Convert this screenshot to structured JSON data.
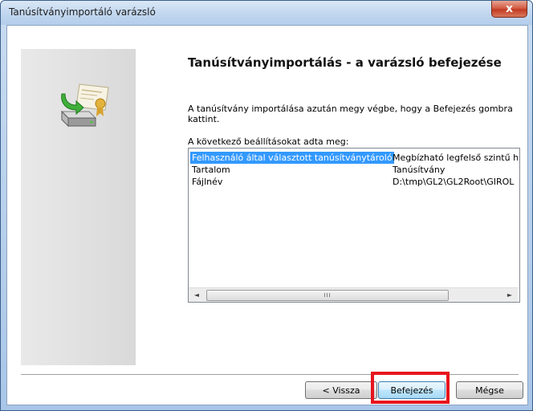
{
  "window": {
    "title": "Tanúsítványimportáló varázsló",
    "close_glyph": "x"
  },
  "icons": {
    "wizard": "certificate-import-icon",
    "close": "close-icon"
  },
  "heading": "Tanúsítványimportálás - a varázsló befejezése",
  "description": "A tanúsítvány importálása azután megy végbe, hogy a Befejezés gombra kattint.",
  "settings_label": "A következő beállításokat adta meg:",
  "settings": [
    {
      "name": "Felhasználó által választott tanúsítványtároló",
      "value": "Megbízható legfelső szintű hi",
      "selected": true
    },
    {
      "name": "Tartalom",
      "value": "Tanúsítvány",
      "selected": false
    },
    {
      "name": "Fájlnév",
      "value": "D:\\tmp\\GL2\\GL2Root\\GIROL",
      "selected": false
    }
  ],
  "scrollbar": {
    "left_arrow": "◄",
    "right_arrow": "►",
    "grip": "III"
  },
  "buttons": {
    "back": "< Vissza",
    "finish": "Befejezés",
    "cancel": "Mégse"
  },
  "colors": {
    "selection": "#3399ff",
    "highlight": "#e8141c"
  }
}
